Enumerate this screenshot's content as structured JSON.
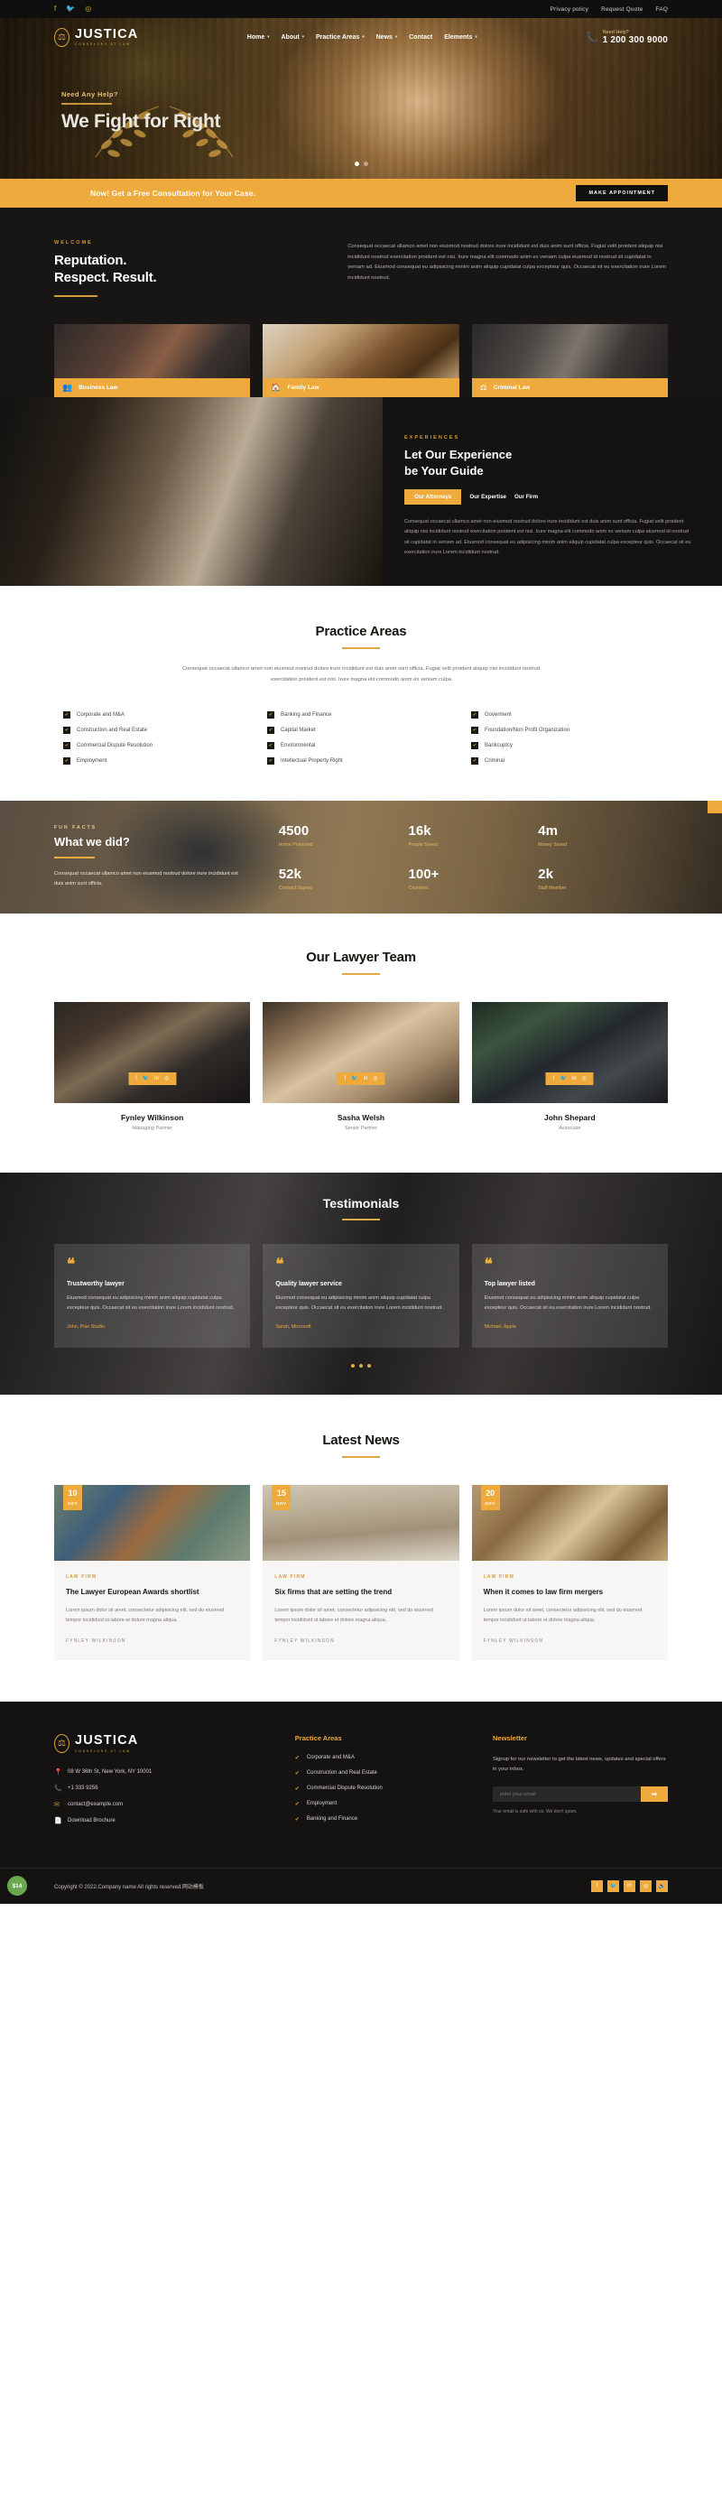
{
  "topbar": {
    "social": [
      {
        "name": "facebook-icon",
        "glyph": "f"
      },
      {
        "name": "twitter-icon",
        "glyph": "🐦"
      },
      {
        "name": "instagram-icon",
        "glyph": "◎"
      }
    ],
    "links": [
      "Privacy policy",
      "Request Quote",
      "FAQ"
    ]
  },
  "nav": {
    "brand_name": "JUSTICA",
    "brand_tagline": "CONSELORS AT LAW",
    "brand_mark": "⚖",
    "items": [
      {
        "label": "Home",
        "caret": "▾"
      },
      {
        "label": "About",
        "caret": "▾"
      },
      {
        "label": "Practice Areas",
        "caret": "▾"
      },
      {
        "label": "News",
        "caret": "▾"
      },
      {
        "label": "Contact",
        "caret": ""
      },
      {
        "label": "Elements",
        "caret": "▾"
      }
    ],
    "help_label": "Need Help?",
    "phone": "1 200 300 9000",
    "phone_icon": "📞"
  },
  "hero": {
    "subtitle": "Need Any Help?",
    "title": "We Fight for Right",
    "slides": 2,
    "active_slide": 1
  },
  "cta": {
    "text": "Now! Get a Free Consultation for Your Case.",
    "button": "MAKE APPOINTMENT"
  },
  "welcome": {
    "eyebrow": "WELCOME",
    "heading_line1": "Reputation.",
    "heading_line2": "Respect. Result.",
    "paragraph": "Consequat occaecat ullamco amet non eiusmod nostrud dolore irure incididunt est duis anim sunt officia. Fugiat velit proident aliquip nisi incididunt nostrud exercitation proident est nisi. Irure magna elit commodo anim ex veniam culpa eiusmod id nostrud sit cupidatat in veniam ad. Eiusmod consequat eu adipisicing minim anim aliquip cupidatat culpa excepteur quis. Occaecat sit eu exercitation irure Lorem incididunt nostrud.",
    "services": [
      {
        "label": "Business Law",
        "icon": "👥"
      },
      {
        "label": "Family Law",
        "icon": "🏠"
      },
      {
        "label": "Criminal Law",
        "icon": "⚖"
      }
    ]
  },
  "experience": {
    "eyebrow": "EXPERIENCES",
    "heading_line1": "Let Our Experience",
    "heading_line2": "be Your Guide",
    "tabs": [
      {
        "label": "Our Attorneys",
        "active": true
      },
      {
        "label": "Our Expertise",
        "active": false
      },
      {
        "label": "Our Firm",
        "active": false
      }
    ],
    "paragraph": "Consequat occaecat ullamco amet non eiusmod nostrud dolore irure incididunt est duis anim sunt officia. Fugiat velit proident aliquip nisi incididunt nostrud exercitation proident est nisi. Irure magna elit commodo anim ex veniam culpa eiusmod id nostrud sit cupidatat in veniam ad. Eiusmod consequat eu adipisicing minim anim aliquip cupidatat culpa excepteur quis. Occaecat sit eu exercitation irure Lorem incididunt nostrud."
  },
  "practice": {
    "heading": "Practice Areas",
    "paragraph": "Consequat occaecat ullamco amet non eiusmod nostrud dolore irure incididunt est duis anim sunt officia. Fugiat velit proident aliquip nisi incididunt nostrud exercitation proident est nisi. Irure magna elit commodo anim ex veniam culpa",
    "check": "✔",
    "col1": [
      "Corporate and M&A",
      "Construction and Real Estate",
      "Commercial Dispute Resolution",
      "Employment"
    ],
    "col2": [
      "Banking and Finance",
      "Capital Market",
      "Environmental",
      "Intellectual Property Right"
    ],
    "col3": [
      "Goverment",
      "Foundation/Non Profit Organization",
      "Bankcuptcy",
      "Criminal"
    ]
  },
  "funfacts": {
    "eyebrow": "FUN FACTS",
    "heading": "What we did?",
    "paragraph": "Consequat occaecat ullamco amet non eiusmod nostrud dolore irure incididunt est duis anim sunt officia.",
    "stats": [
      {
        "value": "4500",
        "label": "Home Protected"
      },
      {
        "value": "16k",
        "label": "People Saved"
      },
      {
        "value": "4m",
        "label": "Money Saved"
      },
      {
        "value": "52k",
        "label": "Contract Signed"
      },
      {
        "value": "100+",
        "label": "Countries"
      },
      {
        "value": "2k",
        "label": "Staff Member"
      }
    ]
  },
  "team": {
    "heading": "Our Lawyer Team",
    "social": [
      "f",
      "🐦",
      "in",
      "◎"
    ],
    "members": [
      {
        "name": "Fynley Wilkinson",
        "role": "Managing Partner"
      },
      {
        "name": "Sasha Welsh",
        "role": "Senior Partner"
      },
      {
        "name": "John Shepard",
        "role": "Associate"
      }
    ]
  },
  "testimonials": {
    "heading": "Testimonials",
    "quote_mark": "❝",
    "items": [
      {
        "title": "Trustworthy lawyer",
        "text": "Eiusmod consequat eu adipisicing minim anim aliquip cupidatat culpa excepteur quis. Occaecat sit eu exercitation irure Lorem incididunt nostrud.",
        "author": "John, Pixe Studio"
      },
      {
        "title": "Quality lawyer service",
        "text": "Eiusmod consequat eu adipisicing minim anim aliquip cupidatat culpa excepteur quis. Occaecat sit eu exercitation irure Lorem incididunt nostrud.",
        "author": "Sarah, Microsoft"
      },
      {
        "title": "Top lawyer listed",
        "text": "Eiusmod consequat eu adipisicing minim anim aliquip cupidatat culpa excepteur quis. Occaecat sit eu exercitation irure Lorem incididunt nostrud.",
        "author": "Michael, Apple"
      }
    ],
    "dots": 3,
    "active_dot": 1
  },
  "news": {
    "heading": "Latest News",
    "posts": [
      {
        "day": "10",
        "month": "NOV",
        "cat": "LAW FIRM",
        "title": "The Lawyer European Awards shortlist",
        "excerpt": "Lorem ipsum dolor sit amet, consectetur adipisicing elit, sed do eiusmod tempor incididunt ut labore et dolore magna aliqua.",
        "author": "FYNLEY WILKINSON"
      },
      {
        "day": "15",
        "month": "NOV",
        "cat": "LAW FIRM",
        "title": "Six firms that are setting the trend",
        "excerpt": "Lorem ipsum dolor sit amet, consectetur adipisicing elit, sed do eiusmod tempor incididunt ut labore et dolore magna aliqua.",
        "author": "FYNLEY WILKINSON"
      },
      {
        "day": "20",
        "month": "NOV",
        "cat": "LAW FIRM",
        "title": "When it comes to law firm mergers",
        "excerpt": "Lorem ipsum dolor sit amet, consectetur adipisicing elit, sed do eiusmod tempor incididunt ut labore et dolore magna aliqua.",
        "author": "FYNLEY WILKINSON"
      }
    ]
  },
  "footer": {
    "brand_name": "JUSTICA",
    "brand_tagline": "CONSELORS AT LAW",
    "brand_mark": "⚖",
    "contact": [
      {
        "icon": "📍",
        "text": "08 W 36th St, New York, NY 10001",
        "name": "address"
      },
      {
        "icon": "📞",
        "text": "+1 333 9256",
        "name": "phone"
      },
      {
        "icon": "✉",
        "text": "contact@example.com",
        "name": "email"
      },
      {
        "icon": "📄",
        "text": "Download Brochure",
        "name": "brochure"
      }
    ],
    "practice_heading": "Practice Areas",
    "practice_items": [
      "Corporate and M&A",
      "Construction and Real Estate",
      "Commercial Dispute Resolution",
      "Employment",
      "Banking and Finance"
    ],
    "practice_check": "✔",
    "newsletter_heading": "Newsletter",
    "newsletter_text": "Signup for our newsletter to get the latest news, updates and special offers in your inbox.",
    "newsletter_placeholder": "enter your email",
    "newsletter_button": "➡",
    "newsletter_note": "Your email is safe with us. We don't spam.",
    "copyright": "Copyright © 2022.Company name All rights reserved.网站模板",
    "social": [
      "f",
      "🐦",
      "in",
      "◎",
      "🔊"
    ],
    "badge": "$14"
  },
  "colors": {
    "accent": "#eeaa3c",
    "accent_dark": "#d39b35",
    "dark": "#141312",
    "gold_text": "#e6c07a"
  }
}
